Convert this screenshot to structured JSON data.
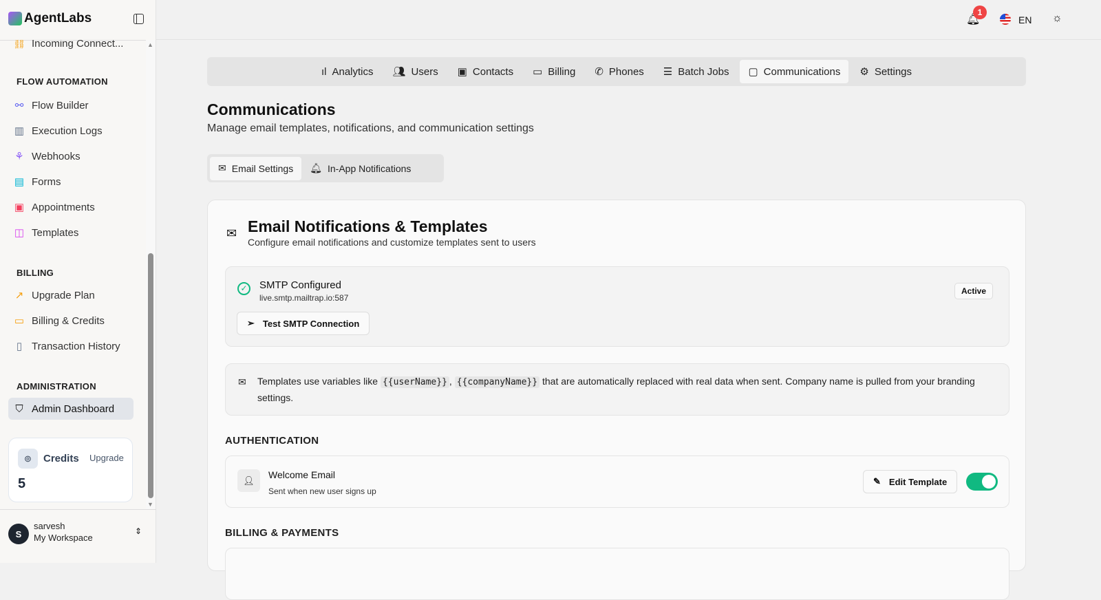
{
  "brand": {
    "name": "AgentLabs"
  },
  "sidebar": {
    "partial_item": "Incoming Connect...",
    "sections": [
      {
        "title": "FLOW AUTOMATION",
        "items": [
          {
            "label": "Flow Builder",
            "icon": "flow-icon",
            "color": "#6366f1"
          },
          {
            "label": "Execution Logs",
            "icon": "bar-chart-icon",
            "color": "#64748b"
          },
          {
            "label": "Webhooks",
            "icon": "webhook-icon",
            "color": "#8b5cf6"
          },
          {
            "label": "Forms",
            "icon": "clipboard-icon",
            "color": "#06b6d4"
          },
          {
            "label": "Appointments",
            "icon": "calendar-icon",
            "color": "#f43f5e"
          },
          {
            "label": "Templates",
            "icon": "layout-icon",
            "color": "#d946ef"
          }
        ]
      },
      {
        "title": "BILLING",
        "items": [
          {
            "label": "Upgrade Plan",
            "icon": "trending-up-icon",
            "color": "#f59e0b"
          },
          {
            "label": "Billing & Credits",
            "icon": "credit-card-icon",
            "color": "#f59e0b"
          },
          {
            "label": "Transaction History",
            "icon": "file-icon",
            "color": "#64748b"
          }
        ]
      },
      {
        "title": "ADMINISTRATION",
        "items": [
          {
            "label": "Admin Dashboard",
            "icon": "shield-icon",
            "color": "#333"
          }
        ]
      }
    ],
    "credits": {
      "label": "Credits",
      "upgrade": "Upgrade",
      "value": "5"
    },
    "user": {
      "initial": "S",
      "name": "sarvesh",
      "workspace": "My Workspace"
    }
  },
  "header": {
    "notifications": "1",
    "language": "EN"
  },
  "nav": {
    "tabs": [
      "Analytics",
      "Users",
      "Contacts",
      "Billing",
      "Phones",
      "Batch Jobs",
      "Communications",
      "Settings"
    ],
    "active": "Communications"
  },
  "page": {
    "title": "Communications",
    "subtitle": "Manage email templates, notifications, and communication settings"
  },
  "subtabs": [
    "Email Settings",
    "In-App Notifications"
  ],
  "card": {
    "title": "Email Notifications & Templates",
    "subtitle": "Configure email notifications and customize templates sent to users",
    "smtp": {
      "title": "SMTP Configured",
      "host": "live.smtp.mailtrap.io:587",
      "status": "Active",
      "test_button": "Test SMTP Connection"
    },
    "info": {
      "pre": "Templates use variables like",
      "var1": "{{userName}}",
      "sep": ",",
      "var2": "{{companyName}}",
      "post": "that are automatically replaced with real data when sent. Company name is pulled from your branding settings."
    },
    "sections": [
      {
        "title": "AUTHENTICATION",
        "templates": [
          {
            "name": "Welcome Email",
            "description": "Sent when new user signs up",
            "edit": "Edit Template",
            "enabled": true
          }
        ]
      },
      {
        "title": "BILLING & PAYMENTS"
      }
    ]
  }
}
